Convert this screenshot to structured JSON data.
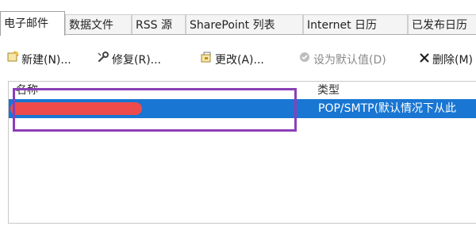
{
  "tabs": [
    {
      "label": "电子邮件",
      "active": true
    },
    {
      "label": "数据文件",
      "active": false
    },
    {
      "label": "RSS 源",
      "active": false
    },
    {
      "label": "SharePoint 列表",
      "active": false
    },
    {
      "label": "Internet 日历",
      "active": false
    },
    {
      "label": "已发布日历",
      "active": false
    }
  ],
  "toolbar": {
    "new_label": "新建(N)...",
    "repair_label": "修复(R)...",
    "change_label": "更改(A)...",
    "default_label": "设为默认值(D)",
    "delete_label": "删除(M)"
  },
  "list": {
    "col_name": "名称",
    "col_type": "类型",
    "rows": [
      {
        "name": "",
        "type": "POP/SMTP(默认情况下从此"
      }
    ]
  },
  "colors": {
    "selection": "#1976d2",
    "redaction": "#ef4b4b",
    "callout": "#8b3fb7"
  }
}
